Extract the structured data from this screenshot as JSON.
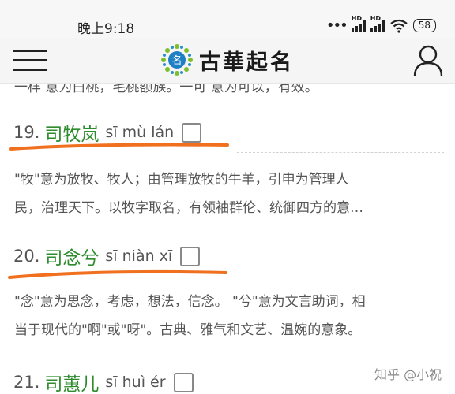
{
  "status_bar": {
    "time": "晚上9:18",
    "signal_1_label": "HD",
    "signal_2_label": "HD",
    "battery": "58"
  },
  "header": {
    "logo_mark_text": "名",
    "logo_text": "古華起名"
  },
  "previous_entry_tail": "一样 意为白桃，毛桃额族。一可 意为可以，有效。",
  "entries": [
    {
      "number": "19.",
      "name": "司牧岚",
      "pinyin": "sī mù lán",
      "description_lines": [
        "\"牧\"意为放牧、牧人；由管理放牧的牛羊，引申为管理人",
        "民，治理天下。以牧字取名，有领袖群伦、统御四方的意…"
      ]
    },
    {
      "number": "20.",
      "name": "司念兮",
      "pinyin": "sī niàn xī",
      "description_lines": [
        "\"念\"意为思念，考虑，想法，信念。 \"兮\"意为文言助词，相",
        "当于现代的\"啊\"或\"呀\"。古典、雅气和文艺、温婉的意象。"
      ]
    },
    {
      "number": "21.",
      "name": "司蕙儿",
      "pinyin": "sī huì ér"
    }
  ],
  "watermark": "知乎 @小祝",
  "colors": {
    "accent_green": "#2e8b2e",
    "annotation_orange": "#f07020"
  },
  "icons": {
    "menu": "hamburger-menu-icon",
    "user": "user-icon",
    "checkbox": "checkbox-icon"
  }
}
